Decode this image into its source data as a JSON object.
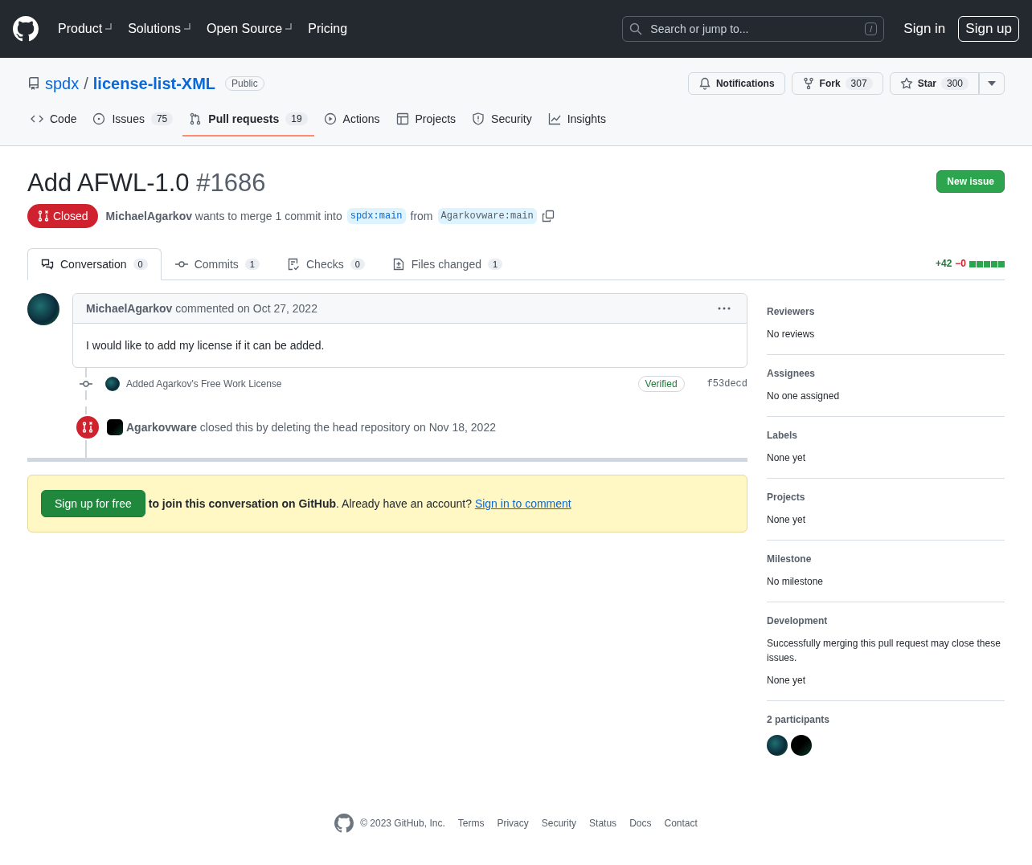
{
  "nav": {
    "items": [
      {
        "label": "Product",
        "dropdown": true
      },
      {
        "label": "Solutions",
        "dropdown": true
      },
      {
        "label": "Open Source",
        "dropdown": true
      },
      {
        "label": "Pricing",
        "dropdown": false
      }
    ],
    "search": {
      "placeholder": "Search or jump to...",
      "shortcut": "/"
    },
    "sign_in": "Sign in",
    "sign_up": "Sign up"
  },
  "repo": {
    "owner": "spdx",
    "separator": "/",
    "name": "license-list-XML",
    "visibility": "Public",
    "actions": [
      {
        "kind": "notifications",
        "label": "Notifications"
      },
      {
        "kind": "fork",
        "label": "Fork",
        "count": "307"
      },
      {
        "kind": "star",
        "label": "Star",
        "count": "300"
      }
    ]
  },
  "repo_tabs": [
    {
      "kind": "code",
      "label": "Code",
      "selected": false
    },
    {
      "kind": "issues",
      "label": "Issues",
      "count": "75",
      "selected": false
    },
    {
      "kind": "pulls",
      "label": "Pull requests",
      "count": "19",
      "selected": true
    },
    {
      "kind": "actions",
      "label": "Actions",
      "selected": false
    },
    {
      "kind": "projects",
      "label": "Projects",
      "selected": false
    },
    {
      "kind": "security",
      "label": "Security",
      "selected": false
    },
    {
      "kind": "insights",
      "label": "Insights",
      "selected": false
    }
  ],
  "pr": {
    "title": "Add AFWL-1.0",
    "number": "#1686",
    "new_issue": "New issue",
    "state": {
      "kind": "closed",
      "label": "Closed"
    },
    "meta": "**MichaelAgarkov** wants to merge 1 commit into",
    "base": "spdx:main",
    "from": "from",
    "head": "Agarkovware:main"
  },
  "pr_tabs": [
    {
      "kind": "conversation",
      "label": "Conversation",
      "count": "0",
      "selected": true
    },
    {
      "kind": "commits",
      "label": "Commits",
      "count": "1",
      "selected": false
    },
    {
      "kind": "checks",
      "label": "Checks",
      "count": "0",
      "selected": false
    },
    {
      "kind": "files",
      "label": "Files changed",
      "count": "1",
      "selected": false
    }
  ],
  "diffstat": {
    "additions": "+42",
    "deletions": "−0"
  },
  "timeline": [
    {
      "kind": "comment",
      "header": "**MichaelAgarkov** commented on Oct 27, 2022",
      "body": "I would like to add my license if it can be added."
    },
    {
      "kind": "commit",
      "message": "Added Agarkov's Free Work License",
      "badge": "Verified",
      "sha": "f53decd"
    },
    {
      "kind": "closed",
      "text": "**Agarkovware** closed this by deleting the head repository on Nov 18, 2022"
    }
  ],
  "signup": {
    "button": "Sign up for free",
    "text": "**to join this conversation on GitHub**. Already have an account?",
    "link": "Sign in to comment"
  },
  "sidebar": [
    {
      "heading": "Reviewers",
      "lines": [
        "No reviews"
      ]
    },
    {
      "heading": "Assignees",
      "lines": [
        "No one assigned"
      ]
    },
    {
      "heading": "Labels",
      "lines": [
        "None yet"
      ]
    },
    {
      "heading": "Projects",
      "lines": [
        "None yet"
      ]
    },
    {
      "heading": "Milestone",
      "lines": [
        "No milestone"
      ]
    },
    {
      "heading": "Development",
      "lines": [
        "Successfully merging this pull request may close these issues.",
        "None yet"
      ]
    }
  ],
  "participants": {
    "heading": "2 participants"
  },
  "footer": {
    "copyright": "© 2023 GitHub, Inc.",
    "links": [
      "Terms",
      "Privacy",
      "Security",
      "Status",
      "Docs",
      "Contact"
    ]
  }
}
